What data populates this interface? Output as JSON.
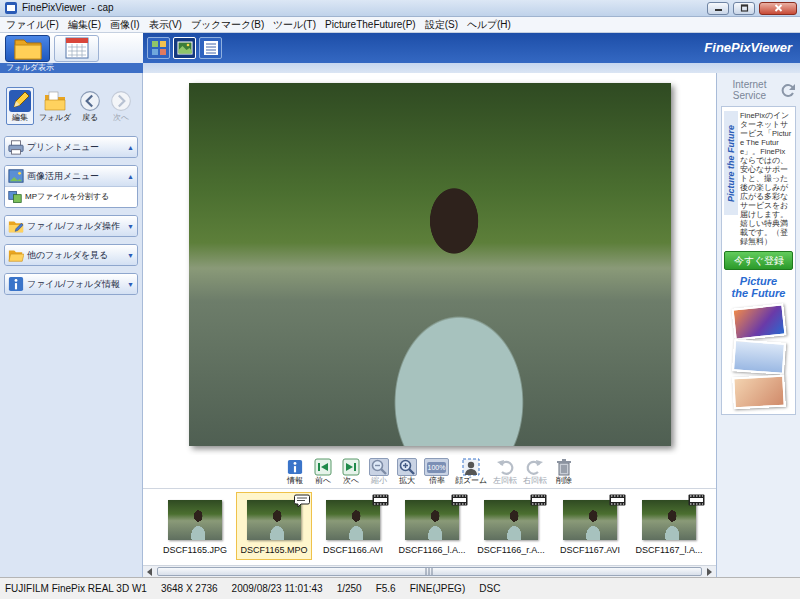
{
  "window": {
    "title": "FinePixViewer  - cap"
  },
  "menu": [
    "ファイル(F)",
    "編集(E)",
    "画像(I)",
    "表示(V)",
    "ブックマーク(B)",
    "ツール(T)",
    "PictureTheFuture(P)",
    "設定(S)",
    "ヘルプ(H)"
  ],
  "mode_tabs": [
    {
      "kind": "folder",
      "selected": true
    },
    {
      "kind": "calendar",
      "selected": false
    }
  ],
  "mode_label": "フォルダ表示",
  "view_buttons": [
    {
      "kind": "thumbnails",
      "selected": false
    },
    {
      "kind": "single",
      "selected": true
    },
    {
      "kind": "list",
      "selected": false
    }
  ],
  "logo": "FinePixViewer",
  "nav_buttons": [
    {
      "label": "編集",
      "kind": "edit",
      "selected": true,
      "disabled": false
    },
    {
      "label": "フォルダ",
      "kind": "folder",
      "selected": false,
      "disabled": false
    },
    {
      "label": "戻る",
      "kind": "back",
      "selected": false,
      "disabled": false
    },
    {
      "label": "次へ",
      "kind": "forward",
      "selected": false,
      "disabled": true
    }
  ],
  "sidebar": {
    "panels": [
      {
        "label": "プリントメニュー",
        "kind": "print",
        "arrow": "▲",
        "expanded": false,
        "items": []
      },
      {
        "label": "画像活用メニュー",
        "kind": "image",
        "arrow": "▲",
        "expanded": true,
        "items": [
          "MPファイルを分割する"
        ]
      },
      {
        "label": "ファイル/フォルダ操作",
        "kind": "file",
        "arrow": "▼",
        "expanded": false,
        "items": []
      },
      {
        "label": "他のフォルダを見る",
        "kind": "folder",
        "arrow": "▼",
        "expanded": false,
        "items": []
      },
      {
        "label": "ファイル/フォルダ情報",
        "kind": "info",
        "arrow": "▼",
        "expanded": false,
        "items": []
      }
    ]
  },
  "viewer_toolbar": [
    {
      "label": "情報",
      "kind": "info",
      "disabled": false
    },
    {
      "label": "前へ",
      "kind": "prev",
      "disabled": false
    },
    {
      "label": "次へ",
      "kind": "next",
      "disabled": false
    },
    {
      "label": "縮小",
      "kind": "zoom-out",
      "disabled": true
    },
    {
      "label": "拡大",
      "kind": "zoom-in",
      "disabled": false
    },
    {
      "label": "倍率",
      "kind": "ratio",
      "disabled": false,
      "icon_text": "100%"
    },
    {
      "label": "顔ズーム",
      "kind": "face",
      "disabled": false
    },
    {
      "label": "左回転",
      "kind": "rotate-left",
      "disabled": true
    },
    {
      "label": "右回転",
      "kind": "rotate-right",
      "disabled": true
    },
    {
      "label": "削除",
      "kind": "delete",
      "disabled": false
    }
  ],
  "thumbnails": [
    {
      "label": "DSCF1165.JPG",
      "kind": "image",
      "selected": false
    },
    {
      "label": "DSCF1165.MPO",
      "kind": "mpo",
      "selected": true
    },
    {
      "label": "DSCF1166.AVI",
      "kind": "movie",
      "selected": false
    },
    {
      "label": "DSCF1166_l.A...",
      "kind": "movie",
      "selected": false
    },
    {
      "label": "DSCF1166_r.A...",
      "kind": "movie",
      "selected": false
    },
    {
      "label": "DSCF1167.AVI",
      "kind": "movie",
      "selected": false
    },
    {
      "label": "DSCF1167_l.A...",
      "kind": "movie",
      "selected": false
    }
  ],
  "internet_service": {
    "title": "Internet Service",
    "brand": "Picture the Future",
    "text": "FinePixのインターネットサービス「Picture The Future」。FinePixならではの、安心なサポートと、撮った後の楽しみが広がる多彩なサービスをお届けします。嬉しい特典満載です。（登録無料）",
    "button": "今すぐ登録",
    "logo_lines": [
      "Picture",
      "the Future"
    ]
  },
  "status_bar": [
    "FUJIFILM FinePix REAL 3D W1",
    "3648 X 2736",
    "2009/08/23 11:01:43",
    "1/250",
    "F5.6",
    "FINE(JPEG)",
    "DSC"
  ]
}
